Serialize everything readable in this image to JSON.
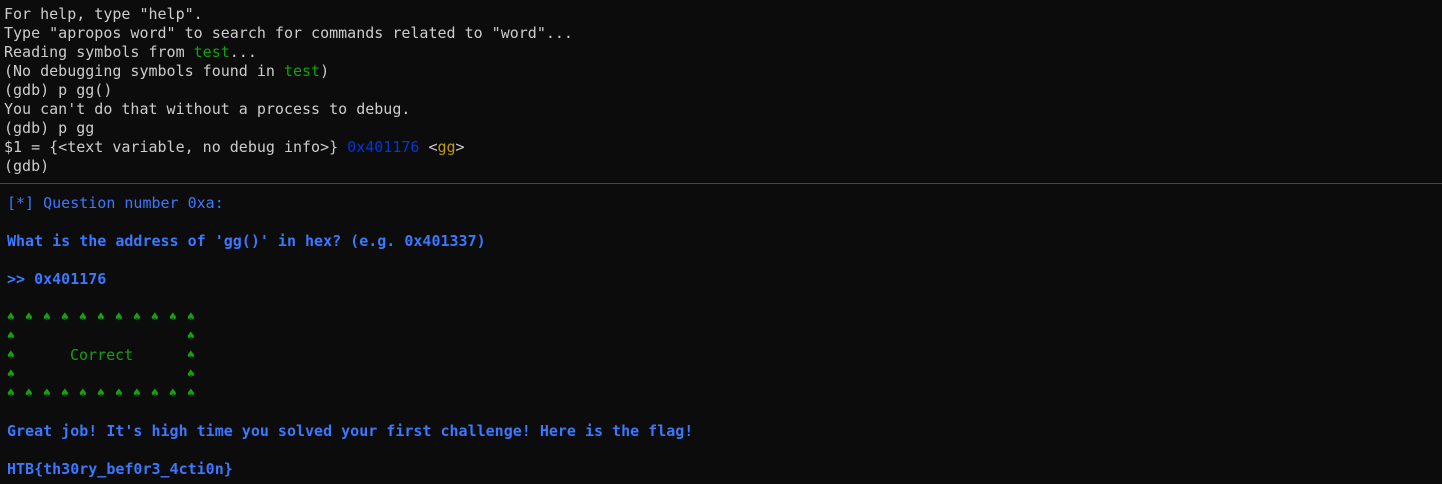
{
  "colors": {
    "background": "#0c0c0c",
    "text": "#cccccc",
    "green": "#13a10e",
    "blue": "#3b78ff",
    "yellow": "#c19c00",
    "dark_blue": "#0037da",
    "divider": "#881798",
    "bold_blue": "#3b78ff"
  },
  "gdb": {
    "line1": "For help, type \"help\".",
    "line2": "Type \"apropos word\" to search for commands related to \"word\"...",
    "line3_prefix": "Reading symbols from ",
    "line3_file": "test",
    "line3_suffix": "...",
    "line4_prefix": "(No debugging symbols found in ",
    "line4_file": "test",
    "line4_suffix": ")",
    "line5": "(gdb) p gg()",
    "line6": "You can't do that without a process to debug.",
    "line7": "(gdb) p gg",
    "line8_prefix": "$1 = {<text variable, no debug info>} ",
    "line8_addr": "0x401176",
    "line8_sym_open": " <",
    "line8_sym": "gg",
    "line8_sym_close": ">",
    "prompt": "(gdb)"
  },
  "challenge": {
    "question_header": "[*] Question number 0xa:",
    "question": "What is the address of 'gg()' in hex? (e.g. 0x401337)",
    "answer": ">> 0x401176",
    "spade_icon": "♠",
    "result_label": "Correct",
    "message": "Great job! It's high time you solved your first challenge! Here is the flag!",
    "flag": "HTB{th30ry_bef0r3_4cti0n}"
  }
}
